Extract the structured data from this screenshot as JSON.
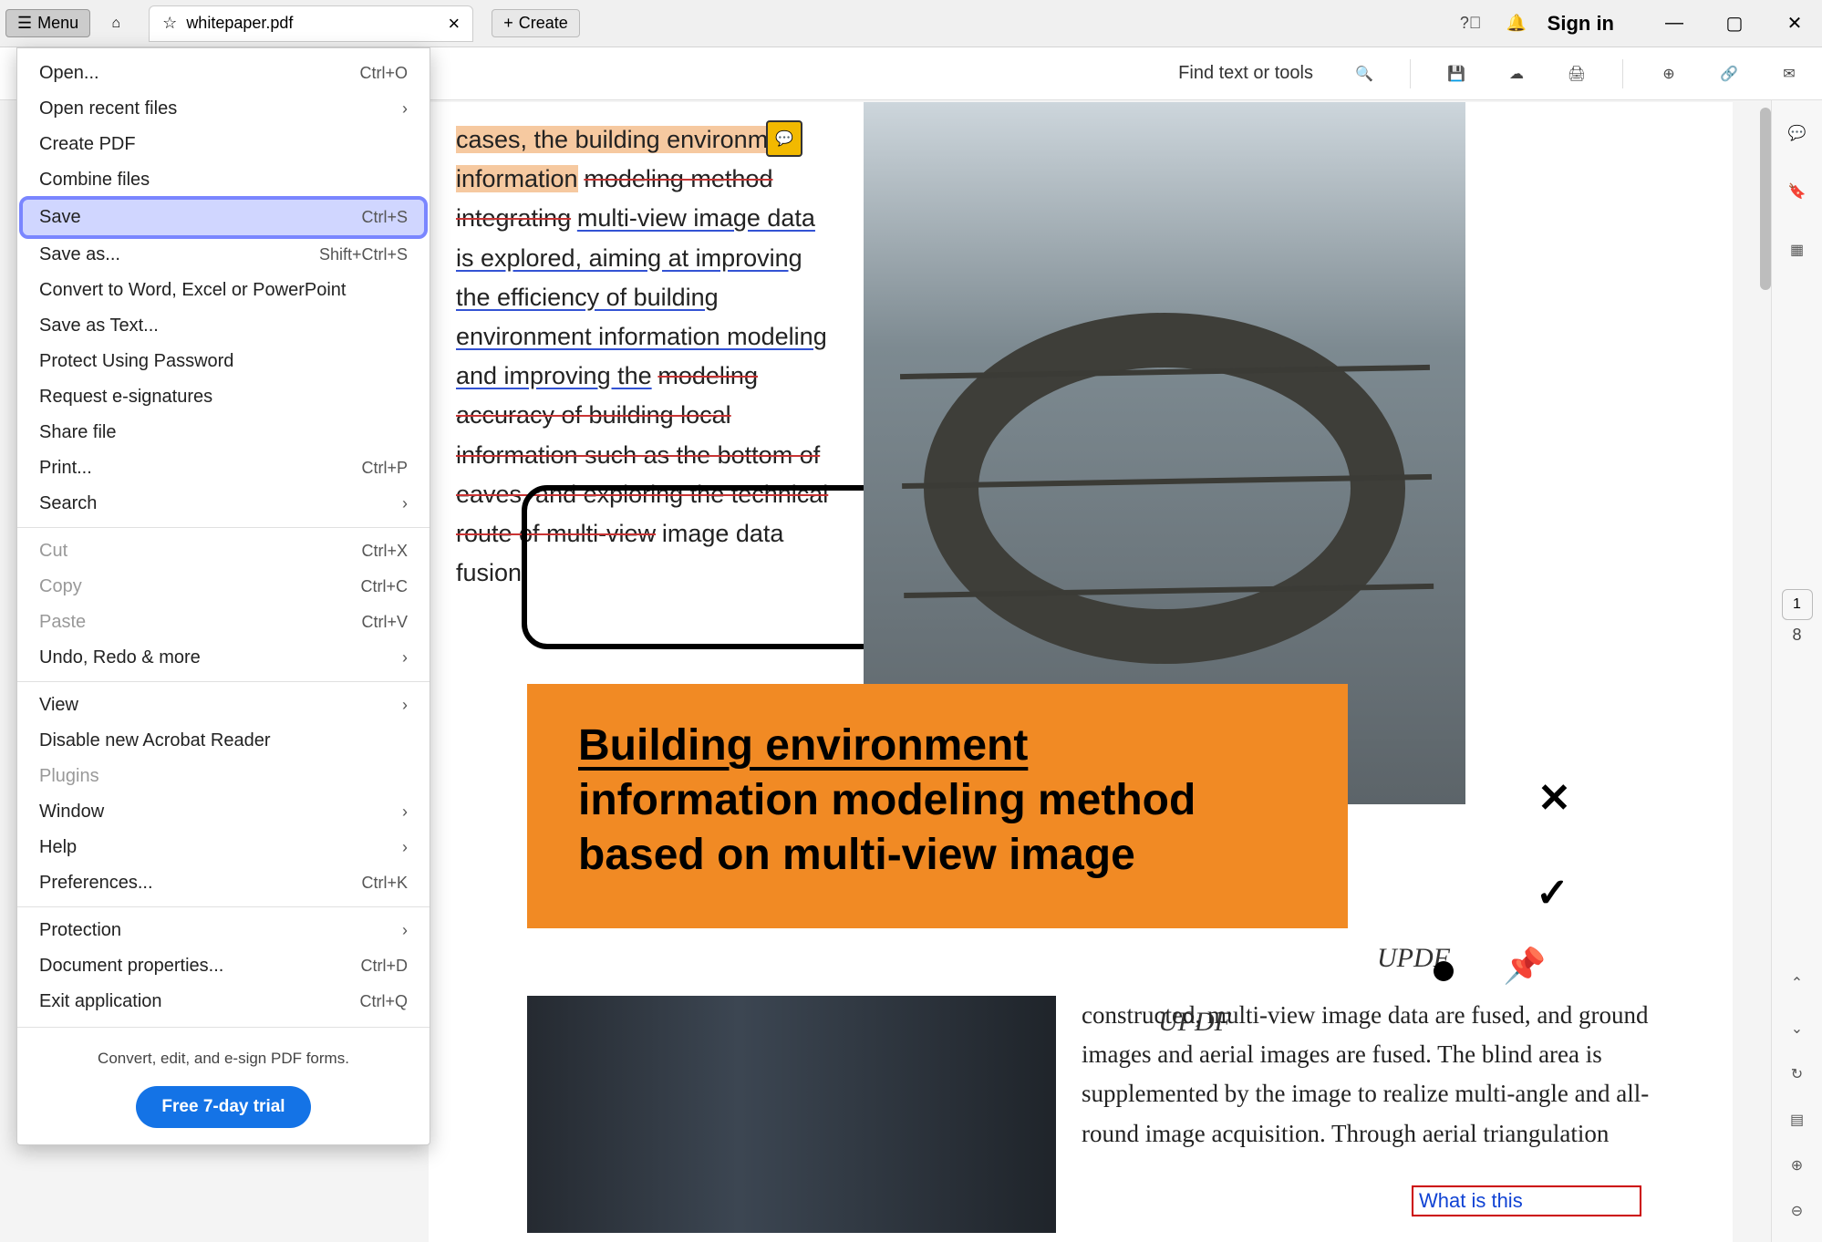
{
  "titlebar": {
    "menu_label": "Menu",
    "tab_name": "whitepaper.pdf",
    "create_label": "Create",
    "signin_label": "Sign in"
  },
  "toolbar": {
    "find_label": "Find text or tools"
  },
  "dropdown": {
    "items": [
      {
        "label": "Open...",
        "shortcut": "Ctrl+O",
        "disabled": false,
        "sub": false
      },
      {
        "label": "Open recent files",
        "shortcut": "",
        "disabled": false,
        "sub": true
      },
      {
        "label": "Create PDF",
        "shortcut": "",
        "disabled": false,
        "sub": false
      },
      {
        "label": "Combine files",
        "shortcut": "",
        "disabled": false,
        "sub": false
      },
      {
        "label": "Save",
        "shortcut": "Ctrl+S",
        "disabled": false,
        "sub": false,
        "highlighted": true
      },
      {
        "label": "Save as...",
        "shortcut": "Shift+Ctrl+S",
        "disabled": false,
        "sub": false
      },
      {
        "label": "Convert to Word, Excel or PowerPoint",
        "shortcut": "",
        "disabled": false,
        "sub": false
      },
      {
        "label": "Save as Text...",
        "shortcut": "",
        "disabled": false,
        "sub": false
      },
      {
        "label": "Protect Using Password",
        "shortcut": "",
        "disabled": false,
        "sub": false
      },
      {
        "label": "Request e-signatures",
        "shortcut": "",
        "disabled": false,
        "sub": false
      },
      {
        "label": "Share file",
        "shortcut": "",
        "disabled": false,
        "sub": false
      },
      {
        "label": "Print...",
        "shortcut": "Ctrl+P",
        "disabled": false,
        "sub": false
      },
      {
        "label": "Search",
        "shortcut": "",
        "disabled": false,
        "sub": true
      },
      {
        "sep": true
      },
      {
        "label": "Cut",
        "shortcut": "Ctrl+X",
        "disabled": true,
        "sub": false
      },
      {
        "label": "Copy",
        "shortcut": "Ctrl+C",
        "disabled": true,
        "sub": false
      },
      {
        "label": "Paste",
        "shortcut": "Ctrl+V",
        "disabled": true,
        "sub": false
      },
      {
        "label": "Undo, Redo & more",
        "shortcut": "",
        "disabled": false,
        "sub": true
      },
      {
        "sep": true
      },
      {
        "label": "View",
        "shortcut": "",
        "disabled": false,
        "sub": true
      },
      {
        "label": "Disable new Acrobat Reader",
        "shortcut": "",
        "disabled": false,
        "sub": false
      },
      {
        "label": "Plugins",
        "shortcut": "",
        "disabled": true,
        "sub": false
      },
      {
        "label": "Window",
        "shortcut": "",
        "disabled": false,
        "sub": true
      },
      {
        "label": "Help",
        "shortcut": "",
        "disabled": false,
        "sub": true
      },
      {
        "label": "Preferences...",
        "shortcut": "Ctrl+K",
        "disabled": false,
        "sub": false
      },
      {
        "sep": true
      },
      {
        "label": "Protection",
        "shortcut": "",
        "disabled": false,
        "sub": true
      },
      {
        "label": "Document properties...",
        "shortcut": "Ctrl+D",
        "disabled": false,
        "sub": false
      },
      {
        "label": "Exit application",
        "shortcut": "Ctrl+Q",
        "disabled": false,
        "sub": false
      }
    ],
    "footer_text": "Convert, edit, and e-sign PDF forms.",
    "trial_label": "Free 7-day trial"
  },
  "doc": {
    "para1_highlight": "cases, the building environment information",
    "para1_strike1": "modeling method integrating",
    "para1_under": "multi-view image data is explored, aiming at improving the efficiency of building environment information modeling and improving the",
    "para1_strike2": "modeling accuracy of building local information such as the bottom of eaves, and exploring the technical route of multi-view",
    "para1_tail": "image data fusion",
    "orange_u": "Building environment",
    "orange_rest": "information modeling method based on multi-view image",
    "updf": "UPDF",
    "para2": "constructed, multi-view image data are fused, and ground images and aerial images are fused. The blind area is supplemented by the image to realize multi-angle and all-round image acquisition. Through aerial triangulation",
    "redbox": "What is this"
  },
  "pages": {
    "current": "1",
    "total": "8"
  }
}
